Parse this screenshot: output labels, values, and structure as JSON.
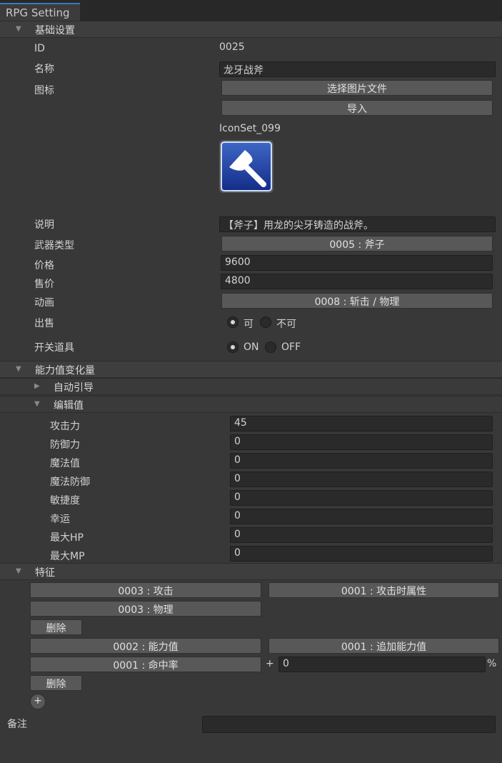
{
  "window": {
    "tab_title": "RPG Setting"
  },
  "basic": {
    "section_title": "基础设置",
    "id_label": "ID",
    "id_value": "0025",
    "name_label": "名称",
    "name_value": "龙牙战斧",
    "icon_label": "图标",
    "select_image_button": "选择图片文件",
    "import_button": "导入",
    "icon_name": "IconSet_099",
    "description_label": "说明",
    "description_value": "【斧子】用龙的尖牙铸造的战斧。",
    "weapon_type_label": "武器类型",
    "weapon_type_value": "0005 : 斧子",
    "price_label": "价格",
    "price_value": "9600",
    "sell_price_label": "售价",
    "sell_price_value": "4800",
    "animation_label": "动画",
    "animation_value": "0008 : 斩击 / 物理",
    "sell_label": "出售",
    "sell_options": [
      "可",
      "不可"
    ],
    "sell_selected": "可",
    "switch_item_label": "开关道具",
    "switch_options": [
      "ON",
      "OFF"
    ],
    "switch_selected": "ON"
  },
  "params": {
    "section_title": "能力值变化量",
    "auto_guide_label": "自动引导",
    "edit_values_label": "编辑值",
    "rows": [
      {
        "label": "攻击力",
        "value": "45"
      },
      {
        "label": "防御力",
        "value": "0"
      },
      {
        "label": "魔法值",
        "value": "0"
      },
      {
        "label": "魔法防御",
        "value": "0"
      },
      {
        "label": "敏捷度",
        "value": "0"
      },
      {
        "label": "幸运",
        "value": "0"
      },
      {
        "label": "最大HP",
        "value": "0"
      },
      {
        "label": "最大MP",
        "value": "0"
      }
    ]
  },
  "traits": {
    "section_title": "特征",
    "trait1": {
      "category": "0003 : 攻击",
      "type": "0001 : 攻击时属性",
      "value": "0003 : 物理",
      "delete": "删除"
    },
    "trait2": {
      "category": "0002 : 能力值",
      "type": "0001 : 追加能力值",
      "param": "0001 : 命中率",
      "plus": "+",
      "amount": "0",
      "unit": "%",
      "delete": "删除"
    },
    "add_button": "+"
  },
  "note": {
    "label": "备注",
    "value": ""
  },
  "colors": {
    "background": "#383838",
    "field": "#2a2a2a",
    "button": "#585858",
    "tab_accent": "#3a79bb"
  }
}
